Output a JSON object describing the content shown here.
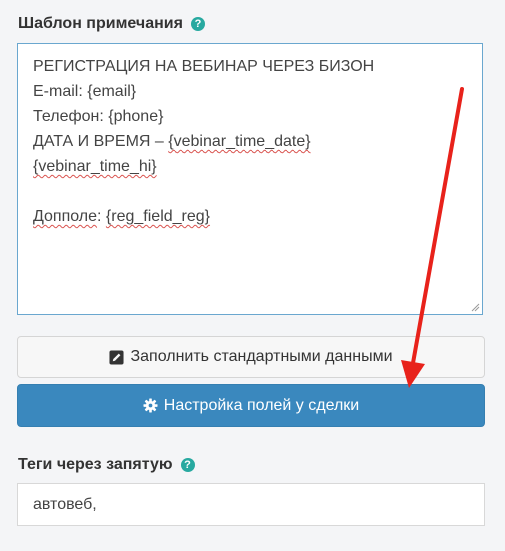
{
  "note_template": {
    "label": "Шаблон примечания",
    "help_glyph": "?",
    "lines": [
      [
        {
          "t": "РЕГИСТРАЦИЯ НА ВЕБИНАР ЧЕРЕЗ БИЗОН"
        }
      ],
      [
        {
          "t": "E-mail: {email}"
        }
      ],
      [
        {
          "t": "Телефон: {phone}"
        }
      ],
      [
        {
          "t": "ДАТА И ВРЕМЯ – "
        },
        {
          "t": "{vebinar_time_date}",
          "s": true
        }
      ],
      [
        {
          "t": "{vebinar_time_hi}",
          "s": true
        }
      ],
      [
        {
          "t": ""
        }
      ],
      [
        {
          "t": "Допполе",
          "s": true
        },
        {
          "t": ": "
        },
        {
          "t": "{reg_field_reg}",
          "s": true
        }
      ]
    ]
  },
  "fill_defaults_button": {
    "label": "Заполнить стандартными данными",
    "icon": "edit-icon"
  },
  "deal_fields_button": {
    "label": "Настройка полей у сделки",
    "icon": "gear-icon"
  },
  "tags": {
    "label": "Теги через запятую",
    "help_glyph": "?",
    "value": "автовеб,"
  },
  "colors": {
    "primary_button": "#3a88be",
    "help_icon": "#27a9a0",
    "arrow": "#e8221b"
  }
}
